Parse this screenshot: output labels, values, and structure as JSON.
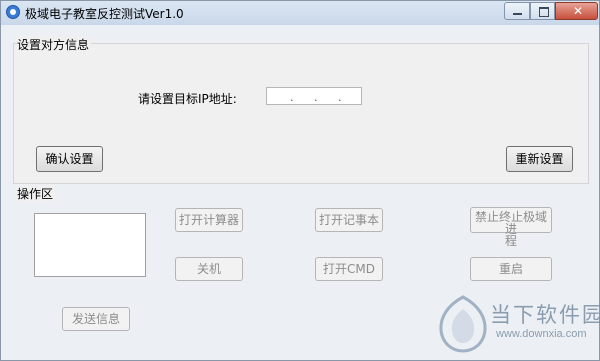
{
  "window": {
    "title": "极域电子教室反控测试Ver1.0"
  },
  "settings_group": {
    "label": "设置对方信息",
    "ip_label": "请设置目标IP地址:",
    "ip_dots": [
      ".",
      ".",
      "."
    ],
    "confirm_button": "确认设置",
    "reset_button": "重新设置"
  },
  "ops_group": {
    "label": "操作区",
    "buttons": {
      "calculator": "打开计算器",
      "notepad": "打开记事本",
      "kill_line1": "禁止终止极域进",
      "kill_line2": "程",
      "shutdown": "关机",
      "cmd": "打开CMD",
      "restart": "重启",
      "send": "发送信息"
    }
  },
  "watermark": {
    "text": "当下软件园",
    "url": "www.downxia.com"
  },
  "colors": {
    "titlebar": "#c9d8ea",
    "window_bg": "#f0f0f0",
    "close_button": "#c7503c",
    "disabled_text": "#8d8d8d"
  }
}
